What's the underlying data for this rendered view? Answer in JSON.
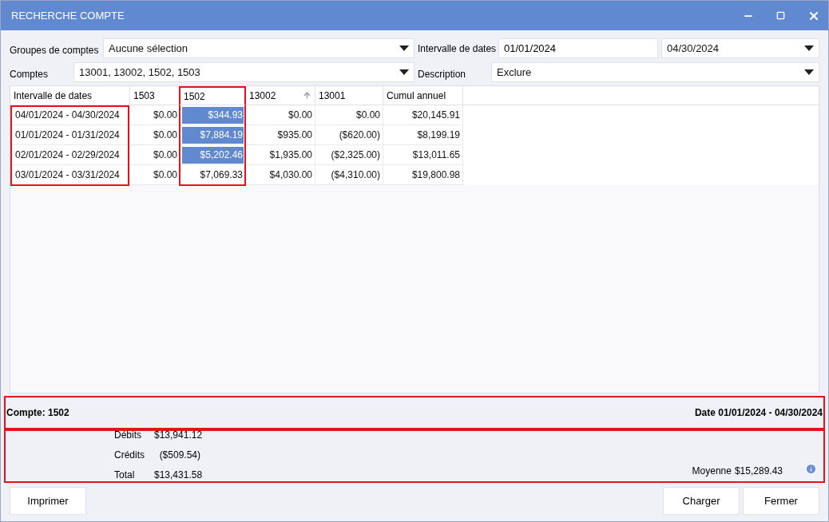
{
  "window": {
    "title": "RECHERCHE COMPTE"
  },
  "filters": {
    "groups_label": "Groupes de comptes",
    "groups_value": "Aucune sélection",
    "range_label": "Intervalle de dates",
    "range_start": "01/01/2024",
    "range_end": "04/30/2024",
    "accounts_label": "Comptes",
    "accounts_value": "13001, 13002, 1502, 1503",
    "description_label": "Description",
    "description_value": "Exclure"
  },
  "table": {
    "columns": [
      {
        "label": "Intervalle de dates",
        "sorted": false,
        "outlined": true,
        "outline_header": false
      },
      {
        "label": "1503",
        "sorted": false,
        "outlined": false,
        "outline_header": false
      },
      {
        "label": "1502",
        "sorted": false,
        "outlined": true,
        "outline_header": true
      },
      {
        "label": "13002",
        "sorted": true,
        "outlined": false,
        "outline_header": false
      },
      {
        "label": "13001",
        "sorted": false,
        "outlined": false,
        "outline_header": false
      },
      {
        "label": "Cumul annuel",
        "sorted": false,
        "outlined": false,
        "outline_header": false
      }
    ],
    "rows": [
      {
        "cells": [
          {
            "text": "04/01/2024 - 04/30/2024",
            "selected": false
          },
          {
            "text": "$0.00",
            "selected": false
          },
          {
            "text": "$344.93",
            "selected": true
          },
          {
            "text": "$0.00",
            "selected": false
          },
          {
            "text": "$0.00",
            "selected": false
          },
          {
            "text": "$20,145.91",
            "selected": false
          }
        ]
      },
      {
        "cells": [
          {
            "text": "01/01/2024 - 01/31/2024",
            "selected": false
          },
          {
            "text": "$0.00",
            "selected": false
          },
          {
            "text": "$7,884.19",
            "selected": true
          },
          {
            "text": "$935.00",
            "selected": false
          },
          {
            "text": "($620.00)",
            "selected": false
          },
          {
            "text": "$8,199.19",
            "selected": false
          }
        ]
      },
      {
        "cells": [
          {
            "text": "02/01/2024 - 02/29/2024",
            "selected": false
          },
          {
            "text": "$0.00",
            "selected": false
          },
          {
            "text": "$5,202.46",
            "selected": true
          },
          {
            "text": "$1,935.00",
            "selected": false
          },
          {
            "text": "($2,325.00)",
            "selected": false
          },
          {
            "text": "$13,011.65",
            "selected": false
          }
        ]
      },
      {
        "cells": [
          {
            "text": "03/01/2024 - 03/31/2024",
            "selected": false
          },
          {
            "text": "$0.00",
            "selected": false
          },
          {
            "text": "$7,069.33",
            "selected": false
          },
          {
            "text": "$4,030.00",
            "selected": false
          },
          {
            "text": "($4,310.00)",
            "selected": false
          },
          {
            "text": "$19,800.98",
            "selected": false
          }
        ]
      }
    ]
  },
  "summary_bar": {
    "account": "Compte: 1502",
    "date": "Date 01/01/2024 - 04/30/2024",
    "highlighted": true
  },
  "stats": {
    "highlighted": true,
    "lines": [
      {
        "label": "Débits",
        "value": "$13,941.12"
      },
      {
        "label": "Crédits",
        "value": "($509.54)"
      },
      {
        "label": "Total",
        "value": "$13,431.58"
      }
    ],
    "average_label": "Moyenne",
    "average_value": "$15,289.43"
  },
  "buttons": {
    "left": [
      "Imprimer"
    ],
    "right": [
      "Charger",
      "Fermer"
    ]
  }
}
